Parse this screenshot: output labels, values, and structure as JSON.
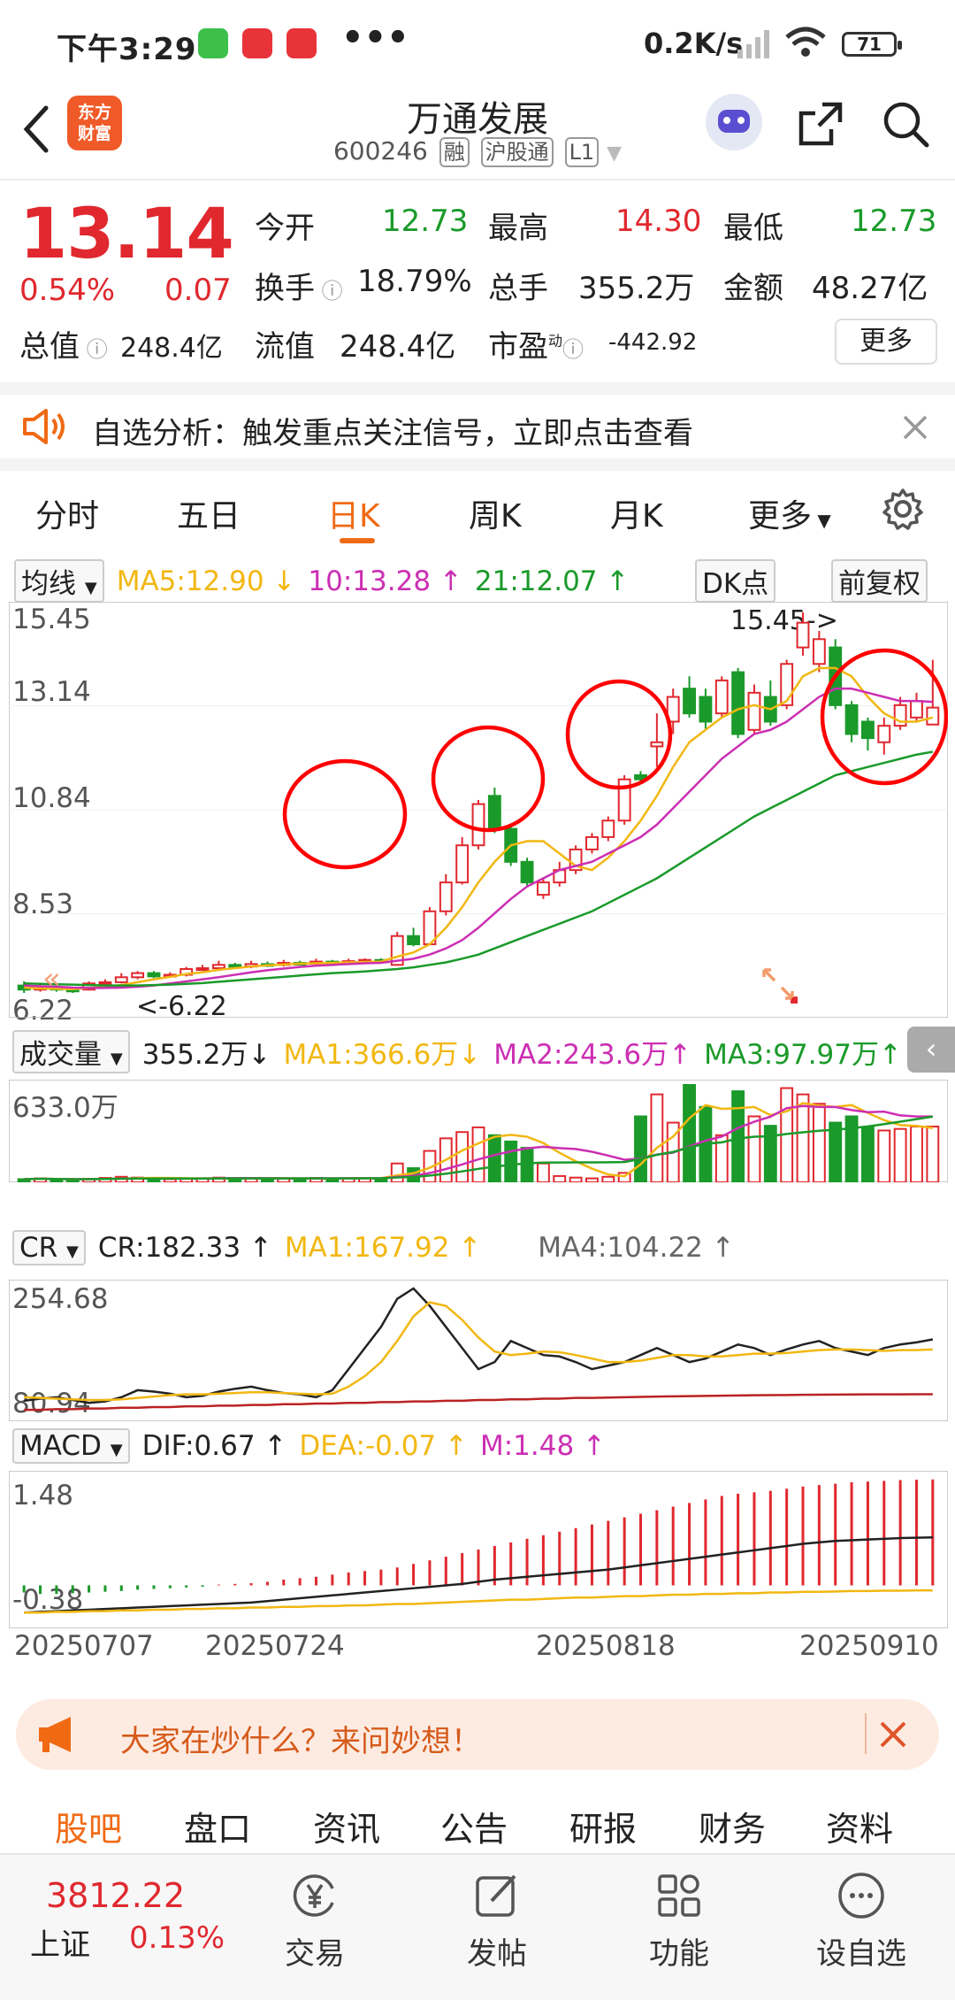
{
  "status_bar": {
    "time": "下午3:29",
    "more": "•••",
    "net_speed": "0.2K/s",
    "battery": "71"
  },
  "header": {
    "logo_text": "东方\n财富",
    "title": "万通发展",
    "code": "600246",
    "tags": [
      "融",
      "沪股通",
      "L1"
    ]
  },
  "quote": {
    "price": "13.14",
    "change_pct": "0.54%",
    "change": "0.07",
    "open_label": "今开",
    "open": "12.73",
    "high_label": "最高",
    "high": "14.30",
    "low_label": "最低",
    "low": "12.73",
    "turnover_label": "换手",
    "turnover": "18.79%",
    "volume_label": "总手",
    "volume": "355.2万",
    "amount_label": "金额",
    "amount": "48.27亿",
    "mcap_label": "总值",
    "mcap": "248.4亿",
    "float_label": "流值",
    "float": "248.4亿",
    "pe_label": "市盈",
    "pe_sup": "动",
    "pe": "-442.92",
    "more_button": "更多"
  },
  "notice": {
    "text": "自选分析：触发重点关注信号，立即点击查看"
  },
  "tabs": [
    "分时",
    "五日",
    "日K",
    "周K",
    "月K",
    "更多"
  ],
  "active_tab": "日K",
  "ma_bar": {
    "select": "均线",
    "ma5": "MA5:12.90 ↓",
    "ma10": "10:13.28 ↑",
    "ma20": "21:12.07 ↑",
    "dk": "DK点",
    "adjust": "前复权"
  },
  "price_axis": [
    "15.45",
    "13.14",
    "10.84",
    "8.53",
    "6.22"
  ],
  "annotations": {
    "high_mark": "15.45->",
    "low_mark": "<-6.22"
  },
  "volume_bar": {
    "select": "成交量",
    "value": "355.2万↓",
    "ma1": "MA1:366.6万↓",
    "ma2": "MA2:243.6万↑",
    "ma3": "MA3:97.97万↑",
    "axis_top": "633.0万"
  },
  "cr_bar": {
    "select": "CR",
    "cr": "CR:182.33 ↑",
    "ma1": "MA1:167.92 ↑",
    "ma4": "MA4:104.22 ↑",
    "axis_top": "254.68",
    "axis_bottom": "80.94"
  },
  "macd_bar": {
    "select": "MACD",
    "dif": "DIF:0.67 ↑",
    "dea": "DEA:-0.07 ↑",
    "m": "M:1.48 ↑",
    "axis_top": "1.48",
    "axis_bottom": "-0.38"
  },
  "dates": [
    "20250707",
    "20250724",
    "20250818",
    "20250910"
  ],
  "promo": {
    "text": "大家在炒什么？来问妙想！"
  },
  "sub_tabs": [
    "股吧",
    "盘口",
    "资讯",
    "公告",
    "研报",
    "财务",
    "资料"
  ],
  "bottom": {
    "index_value": "3812.22",
    "index_name": "上证",
    "index_change": "0.13%",
    "items": [
      "交易",
      "发帖",
      "功能",
      "设自选"
    ]
  },
  "colors": {
    "up": "#e0282e",
    "down": "#1a9a2a",
    "accent": "#f06a14",
    "ma5": "#f2b712",
    "ma10": "#cc2fb3",
    "ma20": "#1a9a2a"
  },
  "chart_data": {
    "type": "candlestick",
    "xlabels": [
      "20250707",
      "20250724",
      "20250818",
      "20250910"
    ],
    "ylim": [
      6.22,
      15.45
    ],
    "candles": [
      {
        "o": 6.4,
        "c": 6.3,
        "h": 6.5,
        "l": 6.22
      },
      {
        "o": 6.3,
        "c": 6.35,
        "h": 6.45,
        "l": 6.25
      },
      {
        "o": 6.35,
        "c": 6.3,
        "h": 6.4,
        "l": 6.25
      },
      {
        "o": 6.3,
        "c": 6.28,
        "h": 6.36,
        "l": 6.22
      },
      {
        "o": 6.3,
        "c": 6.45,
        "h": 6.5,
        "l": 6.28
      },
      {
        "o": 6.45,
        "c": 6.48,
        "h": 6.55,
        "l": 6.4
      },
      {
        "o": 6.48,
        "c": 6.6,
        "h": 6.7,
        "l": 6.45
      },
      {
        "o": 6.6,
        "c": 6.7,
        "h": 6.75,
        "l": 6.55
      },
      {
        "o": 6.7,
        "c": 6.62,
        "h": 6.75,
        "l": 6.58
      },
      {
        "o": 6.62,
        "c": 6.66,
        "h": 6.72,
        "l": 6.6
      },
      {
        "o": 6.66,
        "c": 6.8,
        "h": 6.85,
        "l": 6.62
      },
      {
        "o": 6.8,
        "c": 6.82,
        "h": 6.9,
        "l": 6.75
      },
      {
        "o": 6.82,
        "c": 6.9,
        "h": 7.0,
        "l": 6.78
      },
      {
        "o": 6.9,
        "c": 6.86,
        "h": 6.95,
        "l": 6.82
      },
      {
        "o": 6.86,
        "c": 6.92,
        "h": 7.0,
        "l": 6.82
      },
      {
        "o": 6.92,
        "c": 6.9,
        "h": 6.98,
        "l": 6.85
      },
      {
        "o": 6.9,
        "c": 6.95,
        "h": 7.02,
        "l": 6.86
      },
      {
        "o": 6.95,
        "c": 6.93,
        "h": 7.0,
        "l": 6.9
      },
      {
        "o": 6.93,
        "c": 6.98,
        "h": 7.05,
        "l": 6.9
      },
      {
        "o": 6.98,
        "c": 6.96,
        "h": 7.02,
        "l": 6.92
      },
      {
        "o": 6.96,
        "c": 6.99,
        "h": 7.05,
        "l": 6.93
      },
      {
        "o": 6.99,
        "c": 7.02,
        "h": 7.06,
        "l": 6.95
      },
      {
        "o": 7.02,
        "c": 6.98,
        "h": 7.06,
        "l": 6.94
      },
      {
        "o": 6.9,
        "c": 7.6,
        "h": 7.7,
        "l": 6.88
      },
      {
        "o": 7.6,
        "c": 7.4,
        "h": 7.8,
        "l": 7.35
      },
      {
        "o": 7.4,
        "c": 8.2,
        "h": 8.3,
        "l": 7.38
      },
      {
        "o": 8.2,
        "c": 8.9,
        "h": 9.1,
        "l": 8.1
      },
      {
        "o": 8.9,
        "c": 9.8,
        "h": 10.0,
        "l": 8.85
      },
      {
        "o": 9.8,
        "c": 10.8,
        "h": 10.9,
        "l": 9.7
      },
      {
        "o": 11.0,
        "c": 10.2,
        "h": 11.2,
        "l": 10.1
      },
      {
        "o": 10.2,
        "c": 9.4,
        "h": 10.3,
        "l": 9.3
      },
      {
        "o": 9.4,
        "c": 8.9,
        "h": 9.5,
        "l": 8.8
      },
      {
        "o": 8.6,
        "c": 8.9,
        "h": 9.0,
        "l": 8.5
      },
      {
        "o": 8.9,
        "c": 9.2,
        "h": 9.4,
        "l": 8.8
      },
      {
        "o": 9.2,
        "c": 9.7,
        "h": 9.8,
        "l": 9.1
      },
      {
        "o": 9.7,
        "c": 10.0,
        "h": 10.1,
        "l": 9.6
      },
      {
        "o": 10.0,
        "c": 10.4,
        "h": 10.5,
        "l": 9.9
      },
      {
        "o": 10.4,
        "c": 11.4,
        "h": 11.5,
        "l": 10.3
      },
      {
        "o": 11.5,
        "c": 11.4,
        "h": 11.6,
        "l": 11.3
      },
      {
        "o": 12.2,
        "c": 12.3,
        "h": 13.0,
        "l": 11.7
      },
      {
        "o": 12.8,
        "c": 13.4,
        "h": 13.6,
        "l": 12.5
      },
      {
        "o": 13.6,
        "c": 13.0,
        "h": 13.9,
        "l": 12.9
      },
      {
        "o": 13.4,
        "c": 12.8,
        "h": 13.6,
        "l": 12.6
      },
      {
        "o": 13.0,
        "c": 13.8,
        "h": 13.9,
        "l": 12.9
      },
      {
        "o": 14.0,
        "c": 12.5,
        "h": 14.1,
        "l": 12.4
      },
      {
        "o": 12.6,
        "c": 13.5,
        "h": 13.7,
        "l": 12.5
      },
      {
        "o": 13.4,
        "c": 12.8,
        "h": 13.8,
        "l": 12.7
      },
      {
        "o": 13.2,
        "c": 14.2,
        "h": 14.3,
        "l": 13.1
      },
      {
        "o": 14.6,
        "c": 15.2,
        "h": 15.45,
        "l": 14.4
      },
      {
        "o": 14.2,
        "c": 14.8,
        "h": 15.0,
        "l": 14.0
      },
      {
        "o": 14.6,
        "c": 13.2,
        "h": 14.8,
        "l": 13.1
      },
      {
        "o": 13.2,
        "c": 12.5,
        "h": 13.3,
        "l": 12.3
      },
      {
        "o": 12.8,
        "c": 12.4,
        "h": 12.9,
        "l": 12.1
      },
      {
        "o": 12.3,
        "c": 12.7,
        "h": 12.9,
        "l": 12.0
      },
      {
        "o": 12.7,
        "c": 13.2,
        "h": 13.4,
        "l": 12.6
      },
      {
        "o": 12.9,
        "c": 13.3,
        "h": 13.5,
        "l": 12.8
      },
      {
        "o": 12.73,
        "c": 13.14,
        "h": 14.3,
        "l": 12.73
      }
    ],
    "ma5": [
      6.35,
      6.33,
      6.32,
      6.31,
      6.34,
      6.37,
      6.41,
      6.48,
      6.55,
      6.61,
      6.68,
      6.72,
      6.78,
      6.82,
      6.86,
      6.89,
      6.91,
      6.93,
      6.94,
      6.95,
      6.96,
      6.97,
      6.98,
      7.1,
      7.2,
      7.4,
      7.8,
      8.3,
      8.9,
      9.4,
      9.8,
      9.9,
      9.9,
      9.6,
      9.3,
      9.2,
      9.5,
      9.9,
      10.4,
      11.0,
      11.7,
      12.3,
      12.6,
      12.9,
      13.1,
      13.2,
      13.1,
      13.3,
      13.9,
      14.1,
      14.1,
      13.9,
      13.4,
      13.0,
      12.8,
      12.8,
      12.9
    ],
    "ma10": [
      6.4,
      6.38,
      6.37,
      6.35,
      6.34,
      6.34,
      6.35,
      6.37,
      6.4,
      6.45,
      6.5,
      6.55,
      6.6,
      6.66,
      6.72,
      6.77,
      6.81,
      6.85,
      6.88,
      6.9,
      6.92,
      6.94,
      6.95,
      7.0,
      7.05,
      7.15,
      7.3,
      7.5,
      7.8,
      8.15,
      8.5,
      8.8,
      9.0,
      9.2,
      9.3,
      9.4,
      9.6,
      9.8,
      10.0,
      10.3,
      10.7,
      11.1,
      11.5,
      11.9,
      12.2,
      12.5,
      12.6,
      12.8,
      13.1,
      13.4,
      13.6,
      13.6,
      13.5,
      13.4,
      13.3,
      13.3,
      13.28
    ],
    "ma20": [
      6.45,
      6.44,
      6.43,
      6.42,
      6.41,
      6.4,
      6.4,
      6.4,
      6.41,
      6.42,
      6.44,
      6.46,
      6.49,
      6.52,
      6.55,
      6.58,
      6.61,
      6.64,
      6.67,
      6.7,
      6.72,
      6.74,
      6.77,
      6.8,
      6.84,
      6.9,
      6.96,
      7.05,
      7.15,
      7.3,
      7.45,
      7.6,
      7.75,
      7.9,
      8.05,
      8.2,
      8.4,
      8.6,
      8.8,
      9.0,
      9.25,
      9.5,
      9.75,
      10.0,
      10.25,
      10.5,
      10.7,
      10.9,
      11.1,
      11.3,
      11.5,
      11.6,
      11.7,
      11.8,
      11.9,
      12.0,
      12.07
    ],
    "volume": [
      20,
      25,
      18,
      15,
      22,
      28,
      35,
      30,
      25,
      20,
      22,
      26,
      30,
      28,
      25,
      22,
      24,
      26,
      28,
      24,
      26,
      27,
      25,
      120,
      90,
      200,
      280,
      320,
      350,
      300,
      260,
      220,
      120,
      40,
      30,
      25,
      35,
      60,
      420,
      560,
      380,
      620,
      480,
      300,
      580,
      420,
      360,
      600,
      560,
      500,
      380,
      420,
      350,
      330,
      340,
      355,
      355
    ],
    "cr": [
      95,
      98,
      100,
      96,
      92,
      94,
      100,
      110,
      108,
      105,
      100,
      102,
      108,
      112,
      115,
      110,
      106,
      104,
      100,
      110,
      140,
      170,
      200,
      240,
      254.68,
      230,
      200,
      170,
      140,
      150,
      180,
      170,
      160,
      158,
      150,
      140,
      145,
      150,
      160,
      170,
      160,
      150,
      155,
      165,
      175,
      170,
      160,
      168,
      175,
      180,
      170,
      165,
      160,
      170,
      175,
      178,
      182.33
    ],
    "cr_ma1": [
      100,
      99,
      98,
      97,
      96,
      96,
      97,
      99,
      101,
      103,
      104,
      104,
      105,
      106,
      107,
      107,
      106,
      105,
      104,
      105,
      115,
      130,
      150,
      180,
      215,
      235,
      230,
      210,
      185,
      165,
      160,
      162,
      165,
      164,
      160,
      155,
      150,
      150,
      152,
      156,
      160,
      160,
      158,
      158,
      160,
      162,
      162,
      163,
      165,
      167,
      168,
      168,
      167,
      166,
      167,
      167,
      167.92
    ],
    "cr_ma4": [
      82,
      82,
      83,
      83,
      84,
      84,
      85,
      85,
      86,
      86,
      87,
      87,
      88,
      88,
      89,
      89,
      90,
      90,
      91,
      91,
      92,
      92,
      93,
      93,
      94,
      94,
      95,
      95,
      96,
      96,
      97,
      97,
      98,
      98,
      99,
      99,
      99.5,
      100,
      100.5,
      101,
      101.3,
      101.6,
      101.9,
      102.2,
      102.5,
      102.8,
      103,
      103.2,
      103.4,
      103.6,
      103.8,
      103.9,
      104,
      104.1,
      104.15,
      104.2,
      104.22
    ],
    "dif": [
      -0.38,
      -0.37,
      -0.36,
      -0.35,
      -0.34,
      -0.33,
      -0.32,
      -0.31,
      -0.3,
      -0.29,
      -0.28,
      -0.27,
      -0.26,
      -0.25,
      -0.24,
      -0.22,
      -0.2,
      -0.18,
      -0.16,
      -0.14,
      -0.12,
      -0.1,
      -0.08,
      -0.06,
      -0.04,
      -0.02,
      0,
      0.02,
      0.05,
      0.08,
      0.1,
      0.12,
      0.14,
      0.16,
      0.18,
      0.2,
      0.22,
      0.25,
      0.28,
      0.31,
      0.34,
      0.37,
      0.4,
      0.43,
      0.46,
      0.49,
      0.52,
      0.55,
      0.58,
      0.6,
      0.62,
      0.63,
      0.64,
      0.65,
      0.66,
      0.665,
      0.67
    ],
    "dea": [
      -0.38,
      -0.38,
      -0.37,
      -0.37,
      -0.36,
      -0.36,
      -0.35,
      -0.35,
      -0.34,
      -0.34,
      -0.33,
      -0.33,
      -0.32,
      -0.32,
      -0.31,
      -0.31,
      -0.3,
      -0.3,
      -0.29,
      -0.29,
      -0.28,
      -0.28,
      -0.27,
      -0.26,
      -0.26,
      -0.25,
      -0.24,
      -0.23,
      -0.22,
      -0.21,
      -0.2,
      -0.2,
      -0.19,
      -0.18,
      -0.17,
      -0.17,
      -0.16,
      -0.15,
      -0.15,
      -0.14,
      -0.13,
      -0.13,
      -0.12,
      -0.12,
      -0.11,
      -0.11,
      -0.1,
      -0.1,
      -0.09,
      -0.09,
      -0.085,
      -0.08,
      -0.08,
      -0.075,
      -0.075,
      -0.07,
      -0.07
    ],
    "macd": [
      -0.1,
      -0.12,
      -0.12,
      -0.11,
      -0.1,
      -0.09,
      -0.08,
      -0.06,
      -0.05,
      -0.04,
      -0.03,
      -0.02,
      0.01,
      0.02,
      0.03,
      0.05,
      0.08,
      0.1,
      0.12,
      0.15,
      0.18,
      0.2,
      0.22,
      0.25,
      0.3,
      0.35,
      0.4,
      0.45,
      0.5,
      0.55,
      0.6,
      0.65,
      0.7,
      0.75,
      0.8,
      0.85,
      0.9,
      0.95,
      1.0,
      1.05,
      1.1,
      1.15,
      1.2,
      1.25,
      1.28,
      1.3,
      1.32,
      1.35,
      1.38,
      1.4,
      1.42,
      1.44,
      1.45,
      1.46,
      1.47,
      1.475,
      1.48
    ]
  }
}
